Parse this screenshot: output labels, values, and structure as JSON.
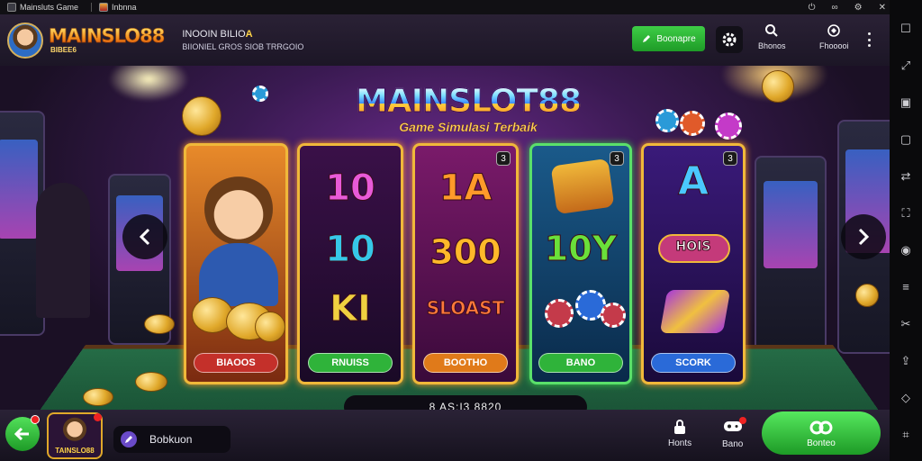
{
  "tabs": [
    {
      "label": "Mainsluts Game"
    },
    {
      "label": "Inbnna"
    }
  ],
  "header": {
    "logo_text": "MAINSLO88",
    "logo_sub": "BIBEE6",
    "line1_prefix": "INOOIN BILIO",
    "line1_accent": "A",
    "line2": "BIIONIEL GROS SIOB TRRGOIO",
    "action_button": "Boonapre",
    "icon_labels": [
      "Bhonos",
      "Fhooooi"
    ]
  },
  "scene": {
    "title": "MAINSLOT88",
    "subtitle": "Game Simulasi Terbaik",
    "status_text": "8 AS:I3 8820",
    "accent": "#f0b83a",
    "cards": [
      {
        "symbols": [],
        "button": "BIAOOS",
        "badge": "",
        "button_color": "#c4302a"
      },
      {
        "symbols": [
          "10",
          "10",
          "KI"
        ],
        "button": "RNUISS",
        "badge": "",
        "button_color": "#2fb33a"
      },
      {
        "symbols": [
          "1A",
          "300",
          "SLOAST"
        ],
        "button": "BOOTHO",
        "badge": "3",
        "button_color": "#e07a1a"
      },
      {
        "symbols": [
          "10Y"
        ],
        "button": "BANO",
        "badge": "3",
        "button_color": "#2fb33a"
      },
      {
        "symbols": [
          "A",
          "HOIS"
        ],
        "button": "SCORK",
        "badge": "3",
        "button_color": "#2a6ad8"
      }
    ]
  },
  "bottom": {
    "mini_logo_text": "TAINSLO88",
    "search_label": "Bobkuon",
    "items": [
      {
        "label": "Honts",
        "icon": "lock-icon"
      },
      {
        "label": "Bano",
        "icon": "gamepad-icon"
      }
    ],
    "play_label": "Bonteo"
  }
}
